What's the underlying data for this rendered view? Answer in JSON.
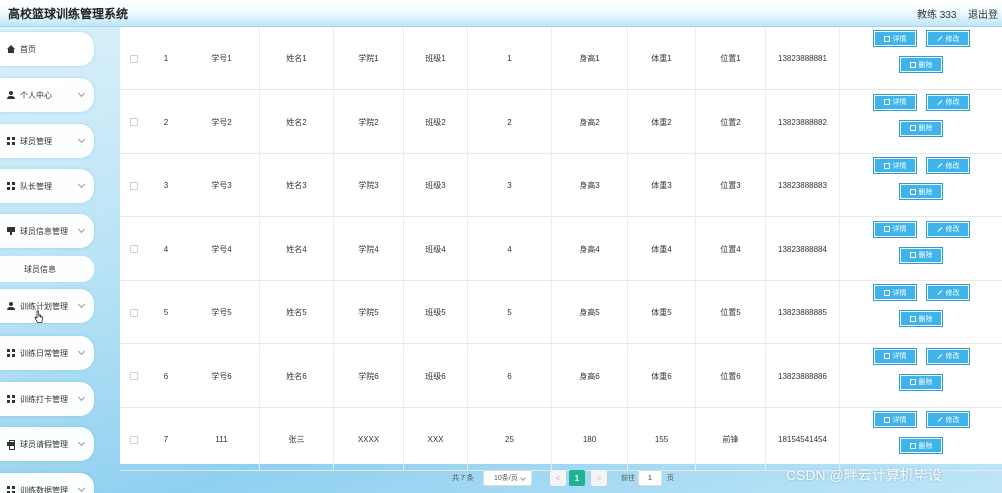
{
  "header": {
    "title": "高校篮球训练管理系统",
    "user": "教练 333",
    "logout": "退出登"
  },
  "sidebar": {
    "items": [
      {
        "label": "首页",
        "icon": "home-icon",
        "expandable": false
      },
      {
        "label": "个人中心",
        "icon": "user-icon",
        "expandable": true
      },
      {
        "label": "球员管理",
        "icon": "grid-icon",
        "expandable": true
      },
      {
        "label": "队长管理",
        "icon": "grid-icon",
        "expandable": true
      },
      {
        "label": "球员信息管理",
        "icon": "flag-icon",
        "expandable": true
      },
      {
        "label": "训练计划管理",
        "icon": "user-icon",
        "expandable": true
      },
      {
        "label": "训练日常管理",
        "icon": "grid-icon",
        "expandable": true
      },
      {
        "label": "训练打卡管理",
        "icon": "grid-icon",
        "expandable": true
      },
      {
        "label": "球员请假管理",
        "icon": "print-icon",
        "expandable": true
      },
      {
        "label": "训练数据管理",
        "icon": "grid-icon",
        "expandable": true
      }
    ],
    "sub_item": "球员信息"
  },
  "actions": {
    "detail": "详情",
    "edit": "修改",
    "delete": "删除"
  },
  "table": {
    "rows": [
      {
        "index": "1",
        "student_no": "学号1",
        "name": "姓名1",
        "college": "学院1",
        "class": "班级1",
        "age": "1",
        "height": "身高1",
        "weight": "体重1",
        "position": "位置1",
        "phone": "13823888881"
      },
      {
        "index": "2",
        "student_no": "学号2",
        "name": "姓名2",
        "college": "学院2",
        "class": "班级2",
        "age": "2",
        "height": "身高2",
        "weight": "体重2",
        "position": "位置2",
        "phone": "13823888882"
      },
      {
        "index": "3",
        "student_no": "学号3",
        "name": "姓名3",
        "college": "学院3",
        "class": "班级3",
        "age": "3",
        "height": "身高3",
        "weight": "体重3",
        "position": "位置3",
        "phone": "13823888883"
      },
      {
        "index": "4",
        "student_no": "学号4",
        "name": "姓名4",
        "college": "学院4",
        "class": "班级4",
        "age": "4",
        "height": "身高4",
        "weight": "体重4",
        "position": "位置4",
        "phone": "13823888884"
      },
      {
        "index": "5",
        "student_no": "学号5",
        "name": "姓名5",
        "college": "学院5",
        "class": "班级5",
        "age": "5",
        "height": "身高5",
        "weight": "体重5",
        "position": "位置5",
        "phone": "13823888885"
      },
      {
        "index": "6",
        "student_no": "学号6",
        "name": "姓名6",
        "college": "学院6",
        "class": "班级6",
        "age": "6",
        "height": "身高6",
        "weight": "体重6",
        "position": "位置6",
        "phone": "13823888886"
      },
      {
        "index": "7",
        "student_no": "111",
        "name": "张三",
        "college": "XXXX",
        "class": "XXX",
        "age": "25",
        "height": "180",
        "weight": "155",
        "position": "前锋",
        "phone": "18154541454"
      }
    ]
  },
  "pagination": {
    "total": "共 7 条",
    "page_size": "10条/页",
    "prev": "<",
    "current": "1",
    "next": ">",
    "goto_label": "前往",
    "goto_value": "1",
    "page_unit": "页"
  },
  "watermark": "CSDN @畔云计算机毕设"
}
